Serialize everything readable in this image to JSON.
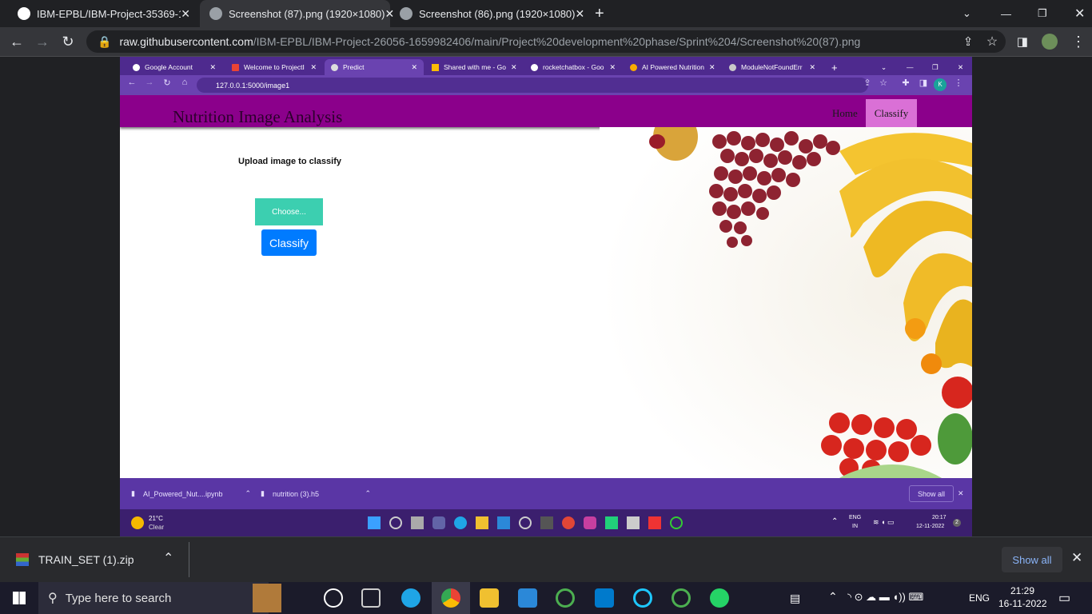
{
  "outer_tabs": [
    {
      "title": "IBM-EPBL/IBM-Project-35369-16"
    },
    {
      "title": "Screenshot (87).png (1920×1080)"
    },
    {
      "title": "Screenshot (86).png (1920×1080)"
    }
  ],
  "outer_url": {
    "host": "raw.githubusercontent.com",
    "path": "/IBM-EPBL/IBM-Project-26056-1659982406/main/Project%20development%20phase/Sprint%204/Screenshot%20(87).png"
  },
  "inner_tabs": [
    {
      "title": "Google Account"
    },
    {
      "title": "Welcome to ProjectI"
    },
    {
      "title": "Predict"
    },
    {
      "title": "Shared with me - Go"
    },
    {
      "title": "rocketchatbox - Goo"
    },
    {
      "title": "AI Powered Nutrition"
    },
    {
      "title": "ModuleNotFoundErr"
    }
  ],
  "inner_url": "127.0.0.1:5000/image1",
  "inner_profile": "K",
  "app": {
    "title": "Nutrition Image Analysis",
    "nav": {
      "home": "Home",
      "classify": "Classify"
    },
    "upload_label": "Upload image to classify",
    "choose_label": "Choose...",
    "classify_button": "Classify"
  },
  "inner_downloads": [
    {
      "name": "AI_Powered_Nut....ipynb"
    },
    {
      "name": "nutrition (3).h5"
    }
  ],
  "inner_show_all": "Show all",
  "inner_weather": {
    "temp": "21°C",
    "cond": "Clear"
  },
  "inner_tray": {
    "lang": "ENG",
    "region": "IN",
    "time": "20:17",
    "date": "12-11-2022",
    "badge": "2"
  },
  "outer_download": {
    "name": "TRAIN_SET (1).zip",
    "show_all": "Show all"
  },
  "taskbar": {
    "search_placeholder": "Type here to search",
    "lang": "ENG",
    "time": "21:29",
    "date": "16-11-2022"
  }
}
